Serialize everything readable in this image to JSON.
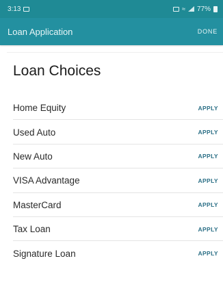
{
  "status_bar": {
    "time": "3:13",
    "battery": "77%"
  },
  "app_bar": {
    "title": "Loan Application",
    "done_label": "DONE"
  },
  "page": {
    "heading": "Loan Choices"
  },
  "loans": [
    {
      "label": "Home Equity",
      "action": "APPLY"
    },
    {
      "label": "Used Auto",
      "action": "APPLY"
    },
    {
      "label": "New Auto",
      "action": "APPLY"
    },
    {
      "label": "VISA Advantage",
      "action": "APPLY"
    },
    {
      "label": "MasterCard",
      "action": "APPLY"
    },
    {
      "label": "Tax Loan",
      "action": "APPLY"
    },
    {
      "label": "Signature Loan",
      "action": "APPLY"
    }
  ],
  "colors": {
    "status_bar": "#1f8a95",
    "app_bar": "#2390a0",
    "apply_text": "#2b6f86"
  },
  "icons": [
    "image-icon",
    "alarm-icon",
    "wifi-icon",
    "signal-icon",
    "battery-icon"
  ]
}
